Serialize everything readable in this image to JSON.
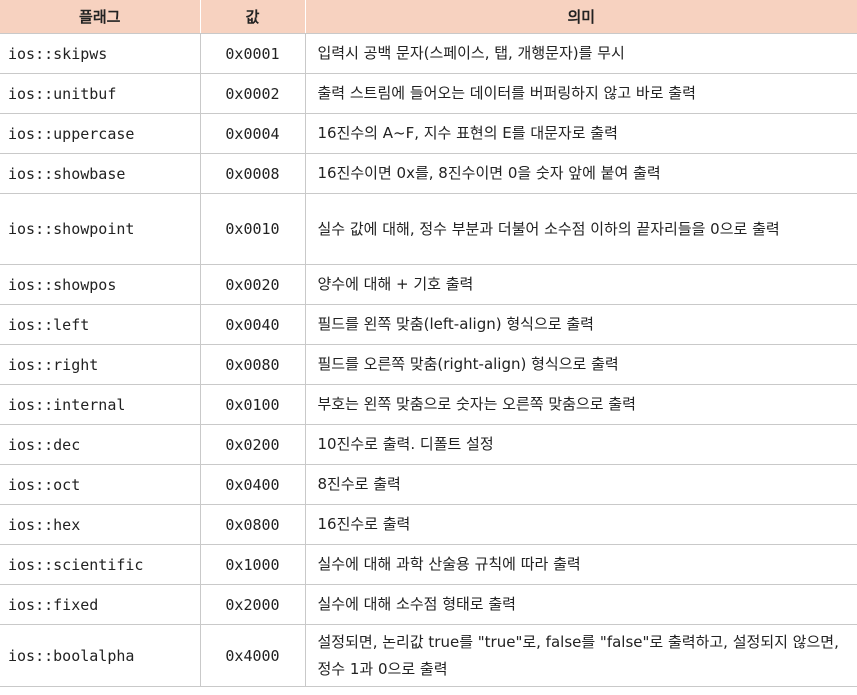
{
  "headers": [
    "플래그",
    "값",
    "의미"
  ],
  "rows": [
    {
      "flag": "ios::skipws",
      "value": "0x0001",
      "meaning": "입력시 공백 문자(스페이스, 탭, 개행문자)를 무시"
    },
    {
      "flag": "ios::unitbuf",
      "value": "0x0002",
      "meaning": "출력 스트림에 들어오는 데이터를 버퍼링하지 않고 바로 출력"
    },
    {
      "flag": "ios::uppercase",
      "value": "0x0004",
      "meaning": "16진수의 A~F, 지수 표현의 E를 대문자로 출력"
    },
    {
      "flag": "ios::showbase",
      "value": "0x0008",
      "meaning": "16진수이면 0x를, 8진수이면 0을 숫자 앞에 붙여 출력"
    },
    {
      "flag": "ios::showpoint",
      "value": "0x0010",
      "meaning": "실수 값에 대해, 정수 부분과 더불어 소수점 이하의 끝자리들을 0으로 출력"
    },
    {
      "flag": "ios::showpos",
      "value": "0x0020",
      "meaning": "양수에 대해 + 기호 출력"
    },
    {
      "flag": "ios::left",
      "value": "0x0040",
      "meaning": "필드를 왼쪽 맞춤(left-align) 형식으로 출력"
    },
    {
      "flag": "ios::right",
      "value": "0x0080",
      "meaning": "필드를 오른쪽 맞춤(right-align) 형식으로 출력"
    },
    {
      "flag": "ios::internal",
      "value": "0x0100",
      "meaning": "부호는 왼쪽 맞춤으로 숫자는 오른쪽 맞춤으로 출력"
    },
    {
      "flag": "ios::dec",
      "value": "0x0200",
      "meaning": "10진수로 출력. 디폴트 설정"
    },
    {
      "flag": "ios::oct",
      "value": "0x0400",
      "meaning": "8진수로 출력"
    },
    {
      "flag": "ios::hex",
      "value": "0x0800",
      "meaning": "16진수로 출력"
    },
    {
      "flag": "ios::scientific",
      "value": "0x1000",
      "meaning": "실수에 대해 과학 산술용 규칙에 따라 출력"
    },
    {
      "flag": "ios::fixed",
      "value": "0x2000",
      "meaning": "실수에 대해 소수점 형태로 출력"
    },
    {
      "flag": "ios::boolalpha",
      "value": "0x4000",
      "meaning": "설정되면, 논리값 true를 \"true\"로, false를 \"false\"로 출력하고, 설정되지 않으면, 정수 1과 0으로 출력"
    }
  ]
}
